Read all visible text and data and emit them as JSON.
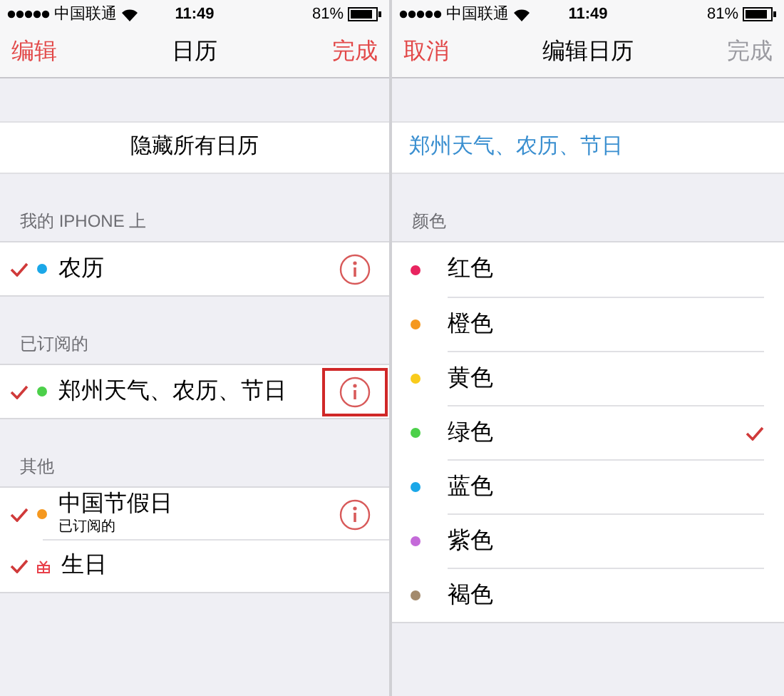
{
  "left": {
    "status_bar": {
      "carrier": "中国联通",
      "time": "11:49",
      "battery": "81%"
    },
    "nav": {
      "left": "编辑",
      "title": "日历",
      "right": "完成",
      "right_disabled": false
    },
    "hide_all": "隐藏所有日历",
    "sections": [
      {
        "header": "我的 IPHONE 上",
        "items": [
          {
            "name": "农历",
            "kind": "dot",
            "color": "#1aa7e8",
            "checked": true,
            "info": true,
            "highlighted": false
          }
        ]
      },
      {
        "header": "已订阅的",
        "items": [
          {
            "name": "郑州天气、农历、节日",
            "kind": "dot",
            "color": "#4cd04a",
            "checked": true,
            "info": true,
            "highlighted": true
          }
        ]
      },
      {
        "header": "其他",
        "items": [
          {
            "name": "中国节假日",
            "subtitle": "已订阅的",
            "kind": "dot",
            "color": "#f5981f",
            "checked": true,
            "info": true,
            "highlighted": false
          },
          {
            "name": "生日",
            "kind": "gift",
            "color": "#e8404a",
            "checked": true,
            "info": false
          }
        ]
      }
    ]
  },
  "right": {
    "status_bar": {
      "carrier": "中国联通",
      "time": "11:49",
      "battery": "81%"
    },
    "nav": {
      "left": "取消",
      "title": "编辑日历",
      "right": "完成",
      "right_disabled": true
    },
    "calendar_name": "郑州天气、农历、节日",
    "colors_header": "颜色",
    "colors": [
      {
        "name": "红色",
        "color": "#e8245f",
        "selected": false
      },
      {
        "name": "橙色",
        "color": "#f5981f",
        "selected": false
      },
      {
        "name": "黄色",
        "color": "#f9cb1b",
        "selected": false
      },
      {
        "name": "绿色",
        "color": "#4cd04a",
        "selected": true
      },
      {
        "name": "蓝色",
        "color": "#1aa7e8",
        "selected": false
      },
      {
        "name": "紫色",
        "color": "#c46ad9",
        "selected": false
      },
      {
        "name": "褐色",
        "color": "#a38a6c",
        "selected": false
      }
    ]
  }
}
